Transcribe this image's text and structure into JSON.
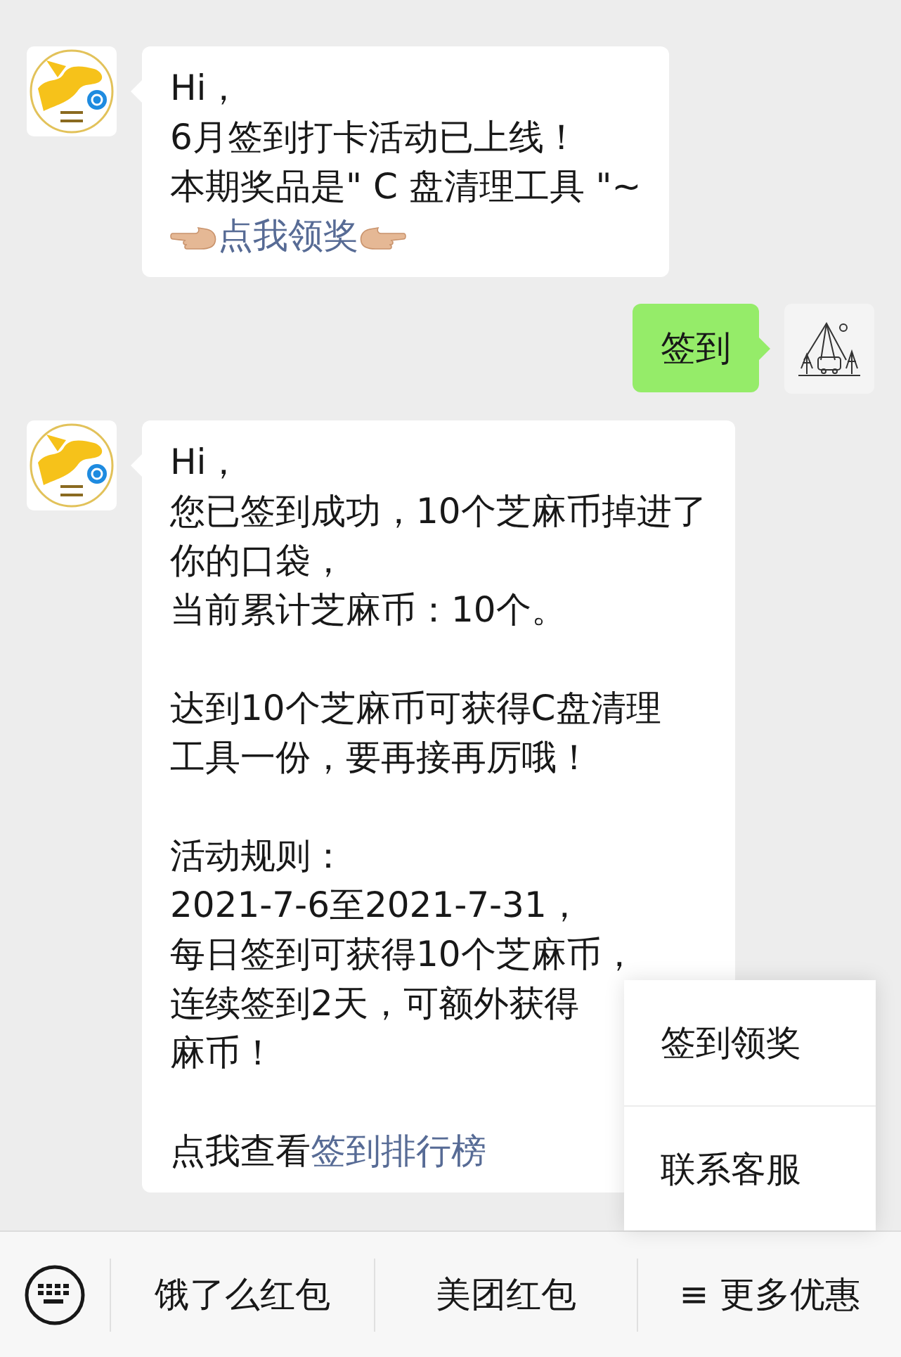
{
  "messages": [
    {
      "kind": "received",
      "paragraphs": [
        [
          {
            "text": "Hi，"
          },
          {
            "text": "6月签到打卡活动已上线！"
          },
          {
            "text": "本期奖品是\" C 盘清理工具 \"~"
          },
          {
            "kind": "pointer-link",
            "link": "点我领奖"
          }
        ]
      ]
    },
    {
      "kind": "sent",
      "paragraphs": [
        [
          {
            "text": "签到"
          }
        ]
      ]
    },
    {
      "kind": "received",
      "paragraphs": [
        [
          {
            "text": "Hi，"
          },
          {
            "text": "您已签到成功，10个芝麻币掉进了"
          },
          {
            "text": "你的口袋，"
          },
          {
            "text": "当前累计芝麻币：10个。"
          }
        ],
        [
          {
            "text": "达到10个芝麻币可获得C盘清理"
          },
          {
            "text": "工具一份，要再接再厉哦！"
          }
        ],
        [
          {
            "text": "活动规则："
          },
          {
            "text": "2021-7-6至2021-7-31，"
          },
          {
            "text": "每日签到可获得10个芝麻币，"
          },
          {
            "text": "连续签到2天，可额外获得"
          },
          {
            "text": "麻币！"
          }
        ],
        [
          {
            "text": "点我查看",
            "link": "签到排行榜"
          }
        ]
      ]
    }
  ],
  "bottom_bar": {
    "menus": [
      {
        "label": "饿了么红包"
      },
      {
        "label": "美团红包"
      },
      {
        "label": "≡ 更多优惠",
        "expanded": true,
        "submenu": [
          "签到领奖",
          "联系客服"
        ]
      }
    ]
  }
}
